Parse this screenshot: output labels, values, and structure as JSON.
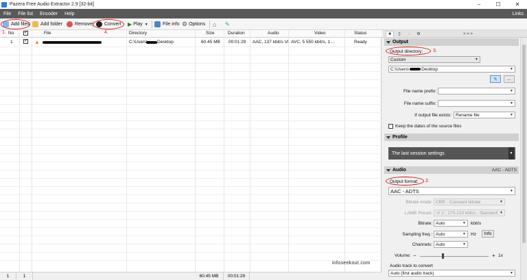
{
  "window": {
    "title": "Pazera Free Audio Extractor 2.9  [32-bit]",
    "minimize": "–",
    "maximize": "☐",
    "close": "✕"
  },
  "menu": {
    "items": [
      "File",
      "File list",
      "Encoder",
      "Help"
    ],
    "links": "Links"
  },
  "toolbar": {
    "add_files": "Add files",
    "add_folder": "Add folder",
    "remove": "Remove",
    "convert": "Convert",
    "play": "Play",
    "file_info": "File info",
    "options": "Options"
  },
  "annotations": {
    "a1": "1.",
    "a2": "2.",
    "a3": "3.",
    "a4": "4."
  },
  "table": {
    "headers": {
      "no": "No",
      "file": "File",
      "directory": "Directory",
      "size": "Size",
      "duration": "Duration",
      "audio": "Audio",
      "video": "Video",
      "status": "Status"
    },
    "rows": [
      {
        "no": "1",
        "directory_prefix": "C:\\Users\\",
        "directory_suffix": "Desktop",
        "size": "60.45 MB",
        "duration": "00:01:29",
        "audio": "AAC, 137 kbit/s VB...",
        "video": "AVC, 5 550 kbit/s, 1 ...",
        "status": "Ready"
      }
    ]
  },
  "statusbar": {
    "count1": "1",
    "count2": "1",
    "size": "60.45 MB",
    "duration": "00:01:29"
  },
  "watermark": "infoseekout.com",
  "panel": {
    "tabs_more": "> > >",
    "output": {
      "section": "Output",
      "directory_label": "Output directory:",
      "directory_mode": "Custom",
      "path_prefix": "C:\\Users\\",
      "path_suffix": "Desktop",
      "browse_btn": "...",
      "prefix_label": "File name prefix:",
      "suffix_label": "File name suffix:",
      "exists_label": "If output file exists:",
      "exists_value": "Rename file",
      "keep_dates": "Keep the dates of the source files"
    },
    "profile": {
      "section": "Profile",
      "value": "The last session settings"
    },
    "audio": {
      "section": "Audio",
      "section_right": "AAC - ADTS",
      "format_label": "Output format:",
      "format_value": "AAC - ADTS",
      "bitrate_mode_label": "Bitrate mode:",
      "bitrate_mode_value": "CBR - Constant bitrate",
      "lame_label": "LAME Preset:",
      "lame_value": "-V 2 : 170-210 kbit/s - Standard",
      "bitrate_label": "Bitrate:",
      "bitrate_value": "Auto",
      "bitrate_unit": "kbit/s",
      "sampling_label": "Sampling freq.:",
      "sampling_value": "Auto",
      "sampling_unit": "Hz",
      "info_btn": "Info",
      "channels_label": "Channels:",
      "channels_value": "Auto",
      "volume_label": "Volume:",
      "volume_minus": "−",
      "volume_plus": "+",
      "volume_value": "1x",
      "track_label": "Audio track to convert",
      "track_value": "Auto (first audio track)"
    }
  }
}
